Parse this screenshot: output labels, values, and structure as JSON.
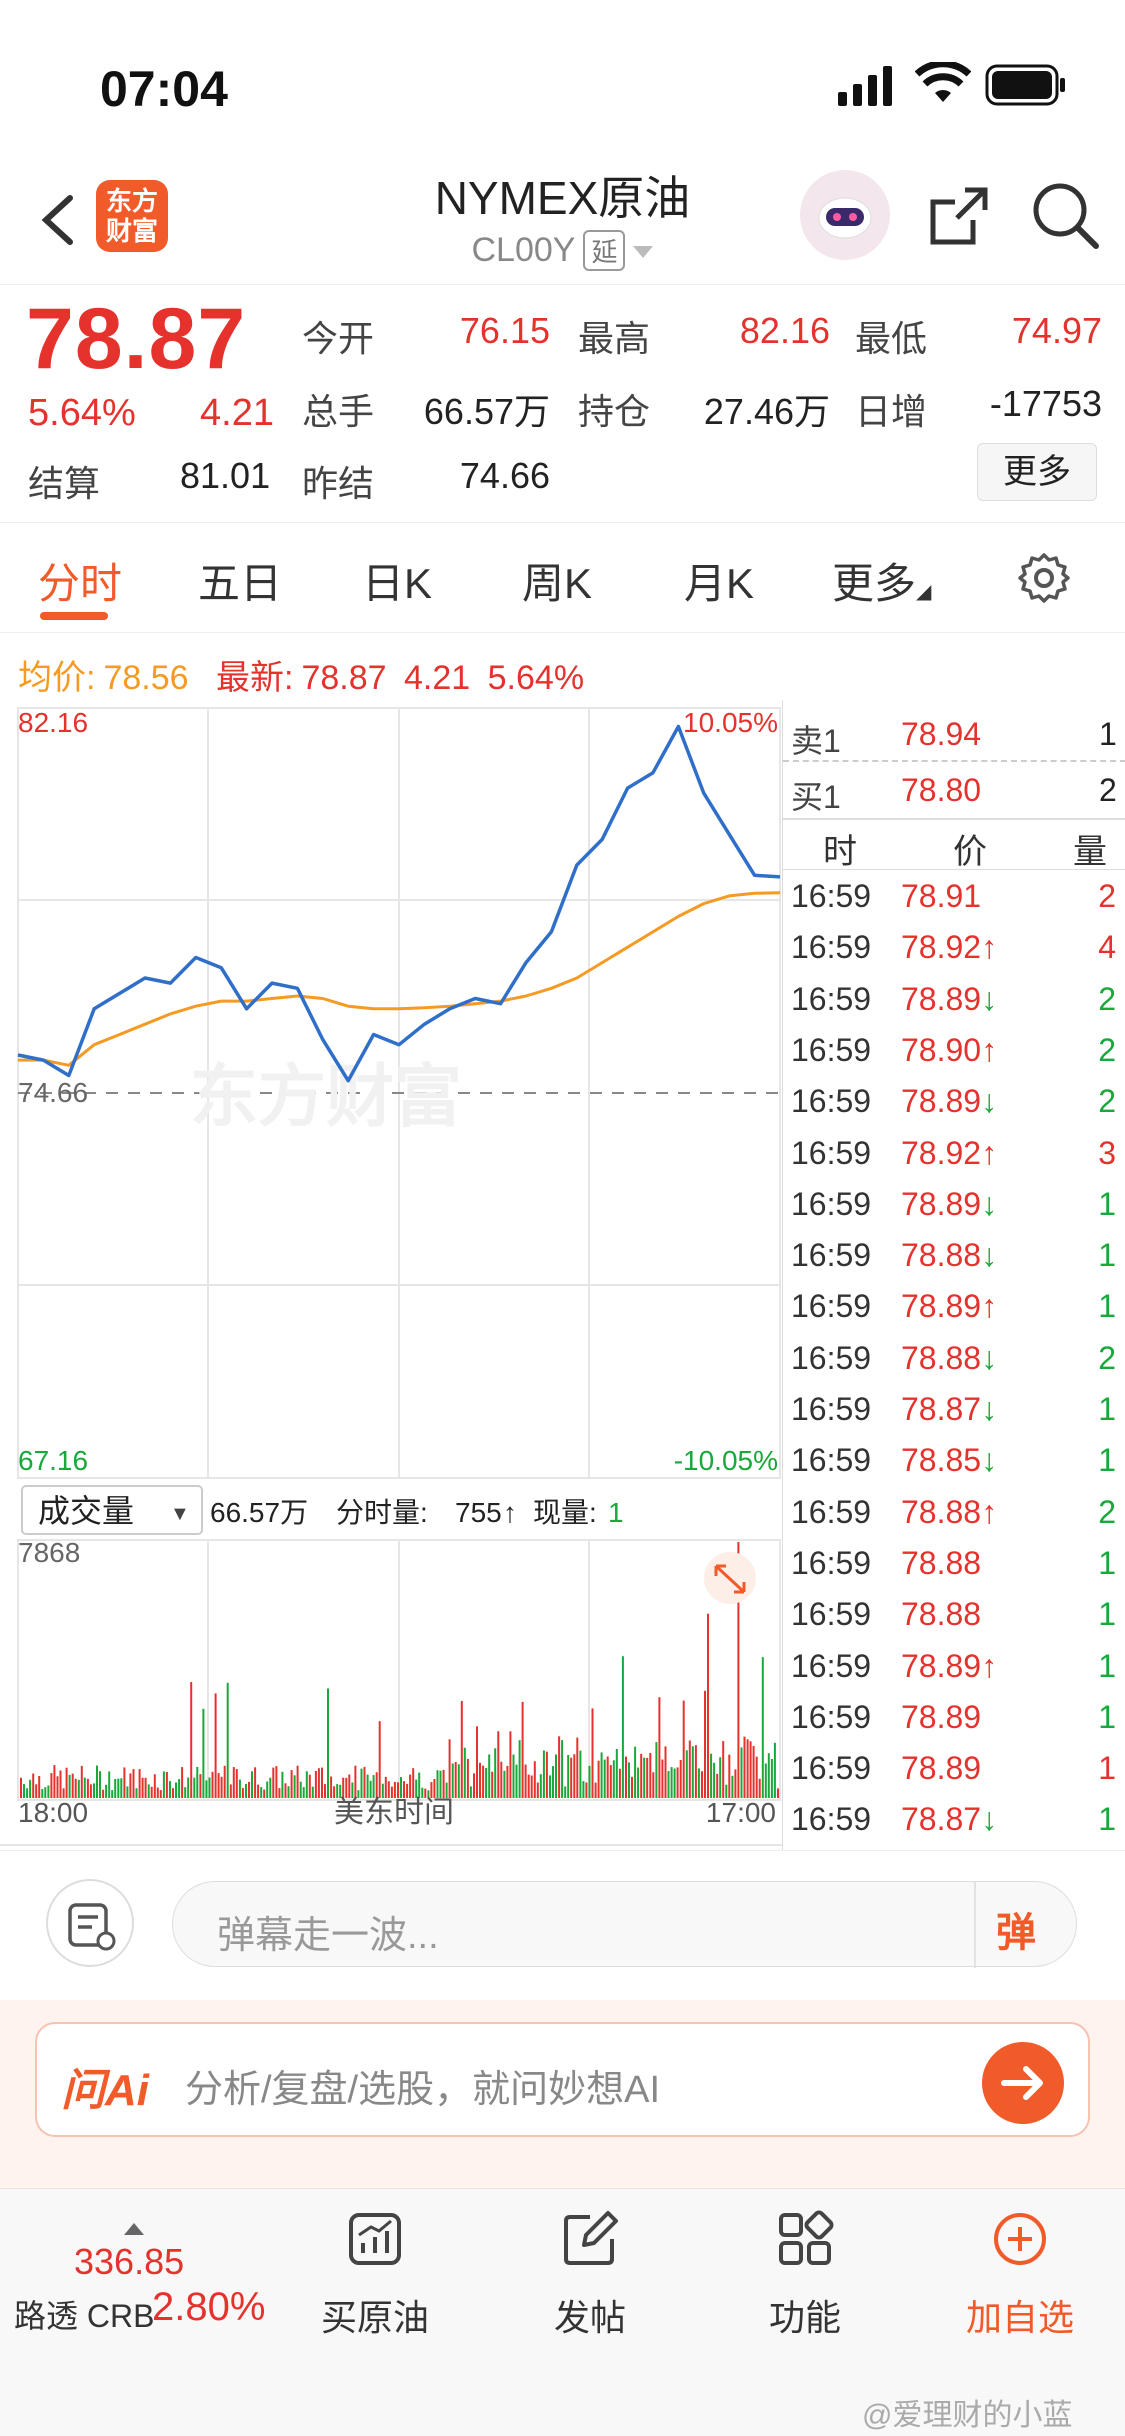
{
  "status": {
    "time": "07:04"
  },
  "header": {
    "title": "NYMEX原油",
    "code": "CL00Y",
    "delay_tag": "延",
    "logo_text_1": "东方",
    "logo_text_2": "财富"
  },
  "quote": {
    "price": "78.87",
    "pct": "5.64%",
    "change": "4.21",
    "settle_label": "结算",
    "settle_value": "81.01",
    "open_label": "今开",
    "open_value": "76.15",
    "high_label": "最高",
    "high_value": "82.16",
    "low_label": "最低",
    "low_value": "74.97",
    "volume_label": "总手",
    "volume_value": "66.57万",
    "oi_label": "持仓",
    "oi_value": "27.46万",
    "daily_inc_label": "日增",
    "daily_inc_value": "-17753",
    "prev_settle_label": "昨结",
    "prev_settle_value": "74.66",
    "more_label": "更多"
  },
  "tabs": [
    "分时",
    "五日",
    "日K",
    "周K",
    "月K",
    "更多"
  ],
  "info_line": {
    "avg_label": "均价:",
    "avg_value": "78.56",
    "latest_label": "最新:",
    "latest_value": "78.87",
    "latest_change": "4.21",
    "latest_pct": "5.64%"
  },
  "chart_labels": {
    "y_high": "82.16",
    "y_high_pct": "10.05%",
    "y_mid": "74.66",
    "y_low": "67.16",
    "y_low_pct": "-10.05%",
    "watermark": "东方财富",
    "vol_selector": "成交量",
    "vol_total": "66.57万",
    "vol_minute_label": "分时量:",
    "vol_minute_value": "755",
    "vol_now_label": "现量:",
    "vol_now_value": "1",
    "vol_max": "7868",
    "x_start": "18:00",
    "x_mid": "美东时间",
    "x_end": "17:00"
  },
  "chart_data": {
    "type": "line",
    "ylim": [
      67.16,
      82.16
    ],
    "reference_line": 74.66,
    "series": [
      {
        "name": "",
        "color": "#2f6fc9",
        "values": [
          75.4,
          75.3,
          75.0,
          76.3,
          76.6,
          76.9,
          76.8,
          77.3,
          77.1,
          76.3,
          76.8,
          76.7,
          75.7,
          74.9,
          75.8,
          75.6,
          76.0,
          76.3,
          76.5,
          76.4,
          77.2,
          77.8,
          79.1,
          79.6,
          80.6,
          80.9,
          81.8,
          80.5,
          79.7,
          78.9,
          78.87
        ]
      },
      {
        "name": "",
        "color": "#f59a23",
        "values": [
          75.3,
          75.3,
          75.2,
          75.6,
          75.8,
          76.0,
          76.2,
          76.35,
          76.45,
          76.45,
          76.5,
          76.55,
          76.5,
          76.35,
          76.3,
          76.3,
          76.32,
          76.35,
          76.4,
          76.45,
          76.55,
          76.7,
          76.9,
          77.2,
          77.5,
          77.8,
          78.1,
          78.35,
          78.5,
          78.55,
          78.56
        ]
      }
    ],
    "volume_max": 7868
  },
  "orderbook": {
    "ask_label": "卖1",
    "ask_price": "78.94",
    "ask_qty": "1",
    "bid_label": "买1",
    "bid_price": "78.80",
    "bid_qty": "2"
  },
  "trades_header": {
    "time": "时",
    "price": "价",
    "qty": "量"
  },
  "trades": [
    {
      "time": "16:59",
      "price": "78.91",
      "arrow": "",
      "qty": "2",
      "qty_color": "red"
    },
    {
      "time": "16:59",
      "price": "78.92",
      "arrow": "↑",
      "qty": "4",
      "qty_color": "red"
    },
    {
      "time": "16:59",
      "price": "78.89",
      "arrow": "↓",
      "qty": "2",
      "qty_color": "green"
    },
    {
      "time": "16:59",
      "price": "78.90",
      "arrow": "↑",
      "qty": "2",
      "qty_color": "green"
    },
    {
      "time": "16:59",
      "price": "78.89",
      "arrow": "↓",
      "qty": "2",
      "qty_color": "green"
    },
    {
      "time": "16:59",
      "price": "78.92",
      "arrow": "↑",
      "qty": "3",
      "qty_color": "red"
    },
    {
      "time": "16:59",
      "price": "78.89",
      "arrow": "↓",
      "qty": "1",
      "qty_color": "green"
    },
    {
      "time": "16:59",
      "price": "78.88",
      "arrow": "↓",
      "qty": "1",
      "qty_color": "green"
    },
    {
      "time": "16:59",
      "price": "78.89",
      "arrow": "↑",
      "qty": "1",
      "qty_color": "green"
    },
    {
      "time": "16:59",
      "price": "78.88",
      "arrow": "↓",
      "qty": "2",
      "qty_color": "green"
    },
    {
      "time": "16:59",
      "price": "78.87",
      "arrow": "↓",
      "qty": "1",
      "qty_color": "green"
    },
    {
      "time": "16:59",
      "price": "78.85",
      "arrow": "↓",
      "qty": "1",
      "qty_color": "green"
    },
    {
      "time": "16:59",
      "price": "78.88",
      "arrow": "↑",
      "qty": "2",
      "qty_color": "green"
    },
    {
      "time": "16:59",
      "price": "78.88",
      "arrow": "",
      "qty": "1",
      "qty_color": "green"
    },
    {
      "time": "16:59",
      "price": "78.88",
      "arrow": "",
      "qty": "1",
      "qty_color": "green"
    },
    {
      "time": "16:59",
      "price": "78.89",
      "arrow": "↑",
      "qty": "1",
      "qty_color": "green"
    },
    {
      "time": "16:59",
      "price": "78.89",
      "arrow": "",
      "qty": "1",
      "qty_color": "green"
    },
    {
      "time": "16:59",
      "price": "78.89",
      "arrow": "",
      "qty": "1",
      "qty_color": "red"
    },
    {
      "time": "16:59",
      "price": "78.87",
      "arrow": "↓",
      "qty": "1",
      "qty_color": "green"
    }
  ],
  "comment": {
    "placeholder": "弹幕走一波...",
    "danmu_label": "弹"
  },
  "ai": {
    "logo": "问Ai",
    "placeholder": "分析/复盘/选股，就问妙想AI"
  },
  "bottom_nav": {
    "crb_value": "336.85",
    "crb_label": "路透 CRB",
    "crb_pct": "2.80%",
    "buy_label": "买原油",
    "post_label": "发帖",
    "func_label": "功能",
    "watch_label": "加自选"
  },
  "watermark_user": "@爱理财的小蓝",
  "colors": {
    "up": "#e5322d",
    "down": "#19a83a",
    "accent": "#f15a29",
    "avg": "#f59a23",
    "line": "#2f6fc9"
  }
}
